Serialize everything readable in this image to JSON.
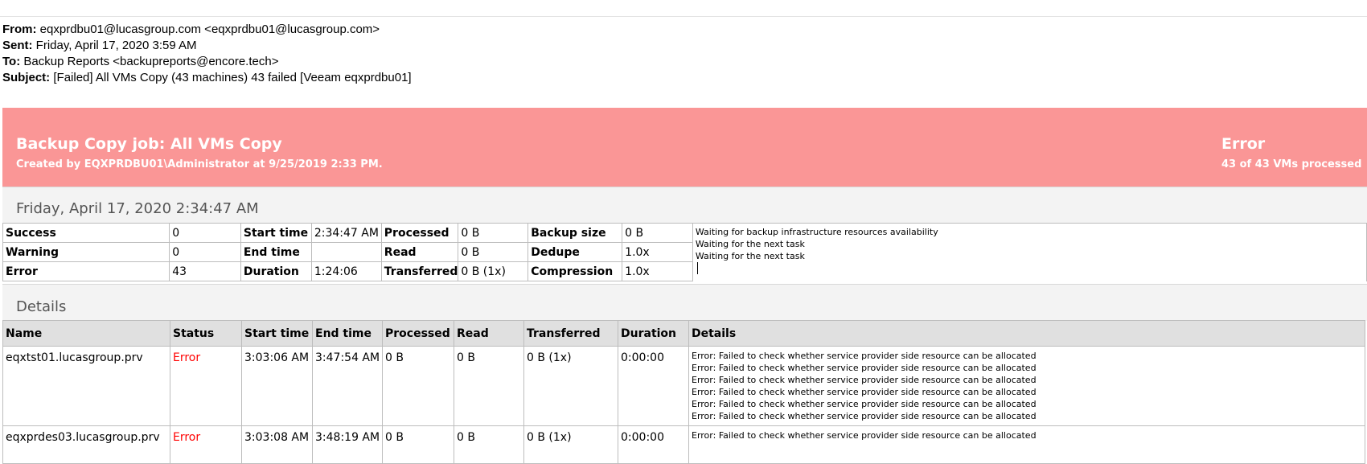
{
  "email": {
    "from_label": "From:",
    "from": "eqxprdbu01@lucasgroup.com <eqxprdbu01@lucasgroup.com>",
    "sent_label": "Sent:",
    "sent": "Friday, April 17, 2020 3:59 AM",
    "to_label": "To:",
    "to": "Backup Reports <backupreports@encore.tech>",
    "subject_label": "Subject:",
    "subject": "[Failed] All VMs Copy (43 machines) 43 failed [Veeam eqxprdbu01]"
  },
  "banner": {
    "title": "Backup Copy job: All VMs Copy",
    "created": "Created by EQXPRDBU01\\Administrator at 9/25/2019 2:33 PM.",
    "status": "Error",
    "processed": "43 of 43 VMs processed",
    "color": "#fa9696"
  },
  "session": {
    "date": "Friday, April 17, 2020 2:34:47 AM",
    "rows": [
      [
        "Success",
        "0",
        "Start time",
        "2:34:47 AM",
        "Processed",
        "0 B",
        "Backup size",
        "0 B"
      ],
      [
        "Warning",
        "0",
        "End time",
        "",
        "Read",
        "0 B",
        "Dedupe",
        "1.0x"
      ],
      [
        "Error",
        "43",
        "Duration",
        "1:24:06",
        "Transferred",
        "0 B (1x)",
        "Compression",
        "1.0x"
      ]
    ],
    "messages": [
      "Waiting for backup infrastructure resources availability",
      "Waiting for the next task",
      "Waiting for the next task"
    ]
  },
  "details": {
    "label": "Details",
    "columns": [
      "Name",
      "Status",
      "Start time",
      "End time",
      "Processed",
      "Read",
      "Transferred",
      "Duration",
      "Details"
    ],
    "rows": [
      {
        "name": "eqxtst01.lucasgroup.prv",
        "status": "Error",
        "start": "3:03:06 AM",
        "end": "3:47:54 AM",
        "processed": "0 B",
        "read": "0 B",
        "transferred": "0 B (1x)",
        "duration": "0:00:00",
        "details": [
          "Error: Failed to check whether service provider side resource can be allocated",
          "Error: Failed to check whether service provider side resource can be allocated",
          "Error: Failed to check whether service provider side resource can be allocated",
          "Error: Failed to check whether service provider side resource can be allocated",
          "Error: Failed to check whether service provider side resource can be allocated",
          "Error: Failed to check whether service provider side resource can be allocated"
        ]
      },
      {
        "name": "eqxprdes03.lucasgroup.prv",
        "status": "Error",
        "start": "3:03:08 AM",
        "end": "3:48:19 AM",
        "processed": "0 B",
        "read": "0 B",
        "transferred": "0 B (1x)",
        "duration": "0:00:00",
        "details": [
          "Error: Failed to check whether service provider side resource can be allocated"
        ]
      }
    ],
    "error_color": "#ff0000"
  }
}
